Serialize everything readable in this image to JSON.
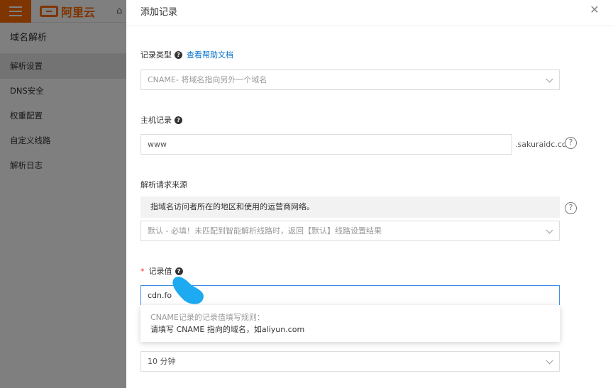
{
  "app": {
    "brand": "阿里云"
  },
  "sidebar": {
    "title": "域名解析",
    "items": [
      {
        "label": "解析设置",
        "active": true
      },
      {
        "label": "DNS安全"
      },
      {
        "label": "权重配置"
      },
      {
        "label": "自定义线路"
      },
      {
        "label": "解析日志"
      }
    ]
  },
  "drawer": {
    "title": "添加记录",
    "record_type": {
      "label": "记录类型",
      "help_link": "查看帮助文档",
      "value": "CNAME- 将域名指向另外一个域名"
    },
    "host_record": {
      "label": "主机记录",
      "value": "www",
      "suffix": ".sakuraidc.cc"
    },
    "resolve_source": {
      "label": "解析请求来源",
      "info": "指域名访问者所在的地区和使用的运营商网络。",
      "value": "默认 - 必填！未匹配到智能解析线路时，返回【默认】线路设置结果"
    },
    "record_value": {
      "required_mark": "*",
      "label": "记录值",
      "value": "cdn.fo",
      "tooltip_title": "CNAME记录的记录值填写规则：",
      "tooltip_body": "请填写 CNAME 指向的域名，如aliyun.com"
    },
    "ttl": {
      "value": "10 分钟"
    }
  },
  "colors": {
    "brand_orange": "#ff6a00",
    "link_blue": "#0070cc",
    "focus_blue": "#3b8fe6",
    "blob_blue": "#1eaaf1"
  }
}
